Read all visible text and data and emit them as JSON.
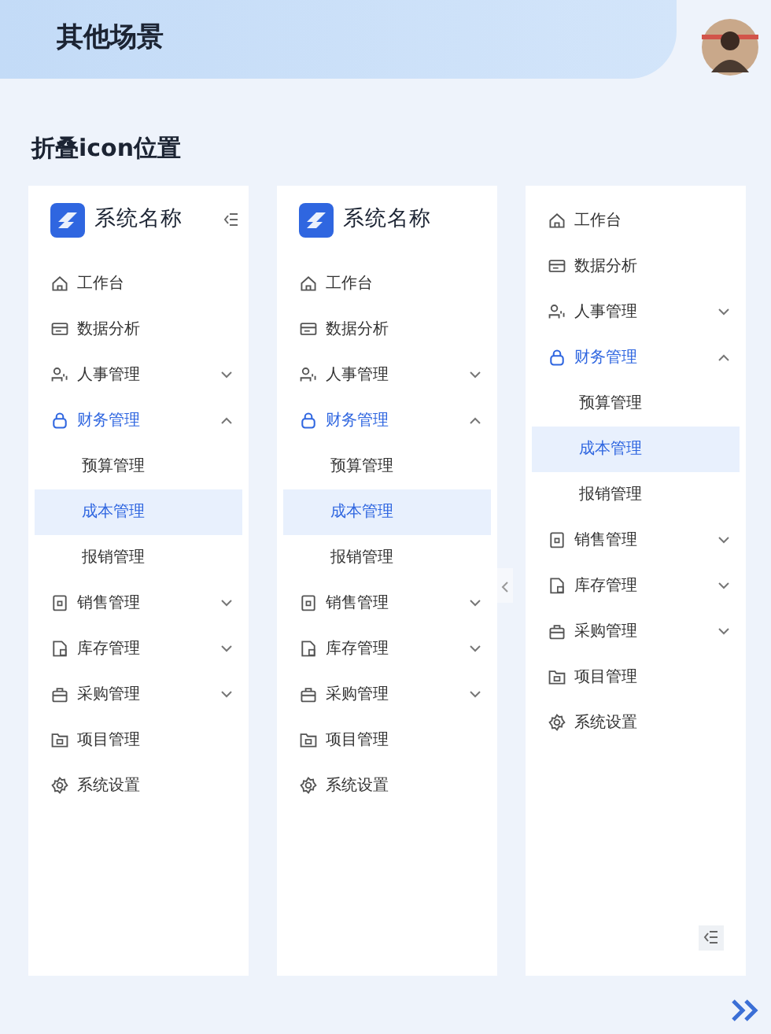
{
  "header": {
    "title": "其他场景"
  },
  "section": {
    "title": "折叠icon位置"
  },
  "panels": [
    {
      "kind": "header",
      "brand": {
        "title": "系统名称"
      },
      "menu": [
        {
          "kind": "link",
          "label": "工作台",
          "selected": false
        },
        {
          "kind": "link",
          "label": "数据分析",
          "selected": false
        },
        {
          "kind": "group",
          "label": "人事管理",
          "selected": false,
          "expanded": false
        },
        {
          "kind": "group",
          "label": "财务管理",
          "selected": false,
          "expanded": true,
          "children": [
            {
              "label": "预算管理",
              "selected": false
            },
            {
              "label": "成本管理",
              "selected": true
            },
            {
              "label": "报销管理",
              "selected": false
            }
          ]
        },
        {
          "kind": "group",
          "label": "销售管理",
          "selected": false,
          "expanded": false
        },
        {
          "kind": "group",
          "label": "库存管理",
          "selected": false,
          "expanded": false
        },
        {
          "kind": "group",
          "label": "采购管理",
          "selected": false,
          "expanded": false
        },
        {
          "kind": "link",
          "label": "项目管理",
          "selected": false
        },
        {
          "kind": "link",
          "label": "系统设置",
          "selected": false
        }
      ]
    },
    {
      "kind": "edge",
      "brand": {
        "title": "系统名称"
      },
      "menu": [
        {
          "kind": "link",
          "label": "工作台",
          "selected": false
        },
        {
          "kind": "link",
          "label": "数据分析",
          "selected": false
        },
        {
          "kind": "group",
          "label": "人事管理",
          "selected": false,
          "expanded": false
        },
        {
          "kind": "group",
          "label": "财务管理",
          "selected": false,
          "expanded": true,
          "children": [
            {
              "label": "预算管理",
              "selected": false
            },
            {
              "label": "成本管理",
              "selected": true
            },
            {
              "label": "报销管理",
              "selected": false
            }
          ]
        },
        {
          "kind": "group",
          "label": "销售管理",
          "selected": false,
          "expanded": false
        },
        {
          "kind": "group",
          "label": "库存管理",
          "selected": false,
          "expanded": false
        },
        {
          "kind": "group",
          "label": "采购管理",
          "selected": false,
          "expanded": false
        },
        {
          "kind": "link",
          "label": "项目管理",
          "selected": false
        },
        {
          "kind": "link",
          "label": "系统设置",
          "selected": false
        }
      ]
    },
    {
      "kind": "bottom",
      "menu": [
        {
          "kind": "link",
          "label": "工作台",
          "selected": false
        },
        {
          "kind": "link",
          "label": "数据分析",
          "selected": false
        },
        {
          "kind": "group",
          "label": "人事管理",
          "selected": false,
          "expanded": false
        },
        {
          "kind": "group",
          "label": "财务管理",
          "selected": false,
          "expanded": true,
          "children": [
            {
              "label": "预算管理",
              "selected": false
            },
            {
              "label": "成本管理",
              "selected": true
            },
            {
              "label": "报销管理",
              "selected": false
            }
          ]
        },
        {
          "kind": "group",
          "label": "销售管理",
          "selected": false,
          "expanded": false
        },
        {
          "kind": "group",
          "label": "库存管理",
          "selected": false,
          "expanded": false
        },
        {
          "kind": "group",
          "label": "采购管理",
          "selected": false,
          "expanded": false
        },
        {
          "kind": "link",
          "label": "项目管理",
          "selected": false
        },
        {
          "kind": "link",
          "label": "系统设置",
          "selected": false
        }
      ]
    }
  ]
}
